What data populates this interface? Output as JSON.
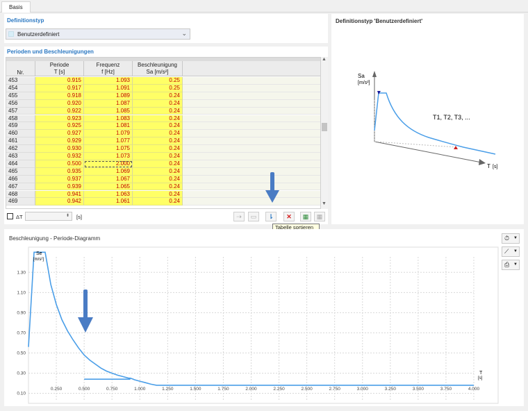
{
  "tab": "Basis",
  "definition": {
    "title": "Definitionstyp",
    "value": "Benutzerdefiniert"
  },
  "table": {
    "title": "Perioden und Beschleunigungen",
    "columns": [
      {
        "line1": "Nr.",
        "line2": ""
      },
      {
        "line1": "Periode",
        "line2": "T [s]"
      },
      {
        "line1": "Frequenz",
        "line2": "f [Hz]"
      },
      {
        "line1": "Beschleunigung",
        "line2": "Sa [m/s²]"
      }
    ],
    "rows": [
      {
        "nr": "453",
        "t": "0.915",
        "f": "1.093",
        "sa": "0.25"
      },
      {
        "nr": "454",
        "t": "0.917",
        "f": "1.091",
        "sa": "0.25"
      },
      {
        "nr": "455",
        "t": "0.918",
        "f": "1.089",
        "sa": "0.24"
      },
      {
        "nr": "456",
        "t": "0.920",
        "f": "1.087",
        "sa": "0.24"
      },
      {
        "nr": "457",
        "t": "0.922",
        "f": "1.085",
        "sa": "0.24"
      },
      {
        "nr": "458",
        "t": "0.923",
        "f": "1.083",
        "sa": "0.24"
      },
      {
        "nr": "459",
        "t": "0.925",
        "f": "1.081",
        "sa": "0.24"
      },
      {
        "nr": "460",
        "t": "0.927",
        "f": "1.079",
        "sa": "0.24"
      },
      {
        "nr": "461",
        "t": "0.929",
        "f": "1.077",
        "sa": "0.24"
      },
      {
        "nr": "462",
        "t": "0.930",
        "f": "1.075",
        "sa": "0.24"
      },
      {
        "nr": "463",
        "t": "0.932",
        "f": "1.073",
        "sa": "0.24"
      },
      {
        "nr": "464",
        "t": "0.500",
        "f": "2.000",
        "sa": "0.24"
      },
      {
        "nr": "465",
        "t": "0.935",
        "f": "1.069",
        "sa": "0.24"
      },
      {
        "nr": "466",
        "t": "0.937",
        "f": "1.067",
        "sa": "0.24"
      },
      {
        "nr": "467",
        "t": "0.939",
        "f": "1.065",
        "sa": "0.24"
      },
      {
        "nr": "468",
        "t": "0.941",
        "f": "1.063",
        "sa": "0.24"
      },
      {
        "nr": "469",
        "t": "0.942",
        "f": "1.061",
        "sa": "0.24"
      }
    ],
    "selected_row_index": 11
  },
  "footer": {
    "delta_label": "ΔT",
    "unit": "[s]"
  },
  "tooltip": "Tabelle sortieren",
  "preview": {
    "title": "Definitionstyp 'Benutzerdefiniert'",
    "y_label": "Sa",
    "y_unit": "[m/s²]",
    "x_label": "T",
    "x_unit": "[s]",
    "periods_label": "T1, T2, T3, ..."
  },
  "diagram": {
    "title": "Beschleunigung - Periode-Diagramm",
    "y_axis_label": "Se",
    "y_axis_unit": "[m/s²]",
    "x_axis_label": "T",
    "x_axis_unit": "[s]"
  },
  "colors": {
    "accent": "#2b78c2",
    "curve": "#4a9ee8",
    "cell_bg": "#ffff66",
    "cell_text": "#c00000",
    "arrow": "#4a7cc4"
  },
  "chart_data": {
    "type": "line",
    "title": "Beschleunigung - Periode-Diagramm",
    "xlabel": "T [s]",
    "ylabel": "Se [m/s²]",
    "xlim": [
      0,
      4.0
    ],
    "x_ticks": [
      "0.250",
      "0.500",
      "0.750",
      "1.000",
      "1.250",
      "1.500",
      "1.750",
      "2.000",
      "2.250",
      "2.500",
      "2.750",
      "3.000",
      "3.250",
      "3.500",
      "3.750",
      "4.000"
    ],
    "y_ticks": [
      "0.10",
      "0.30",
      "0.50",
      "0.70",
      "0.90",
      "1.10",
      "1.30"
    ],
    "ylim": [
      0,
      1.55
    ],
    "grid": true,
    "series": [
      {
        "values": [
          [
            0.0,
            0.56
          ],
          [
            0.05,
            1.5
          ],
          [
            0.15,
            1.5
          ],
          [
            0.2,
            1.18
          ],
          [
            0.25,
            0.98
          ],
          [
            0.3,
            0.83
          ],
          [
            0.35,
            0.72
          ],
          [
            0.4,
            0.63
          ],
          [
            0.45,
            0.55
          ],
          [
            0.5,
            0.48
          ],
          [
            0.55,
            0.43
          ],
          [
            0.6,
            0.39
          ],
          [
            0.65,
            0.35
          ],
          [
            0.7,
            0.32
          ],
          [
            0.75,
            0.3
          ],
          [
            0.8,
            0.28
          ],
          [
            0.85,
            0.265
          ],
          [
            0.9,
            0.25
          ],
          [
            0.915,
            0.25
          ],
          [
            0.942,
            0.24
          ],
          [
            0.95,
            0.235
          ],
          [
            1.0,
            0.22
          ],
          [
            1.05,
            0.205
          ],
          [
            1.1,
            0.19
          ],
          [
            1.15,
            0.18
          ],
          [
            4.0,
            0.18
          ]
        ],
        "segment": [
          [
            0.5,
            0.24
          ],
          [
            0.915,
            0.24
          ]
        ]
      }
    ]
  }
}
